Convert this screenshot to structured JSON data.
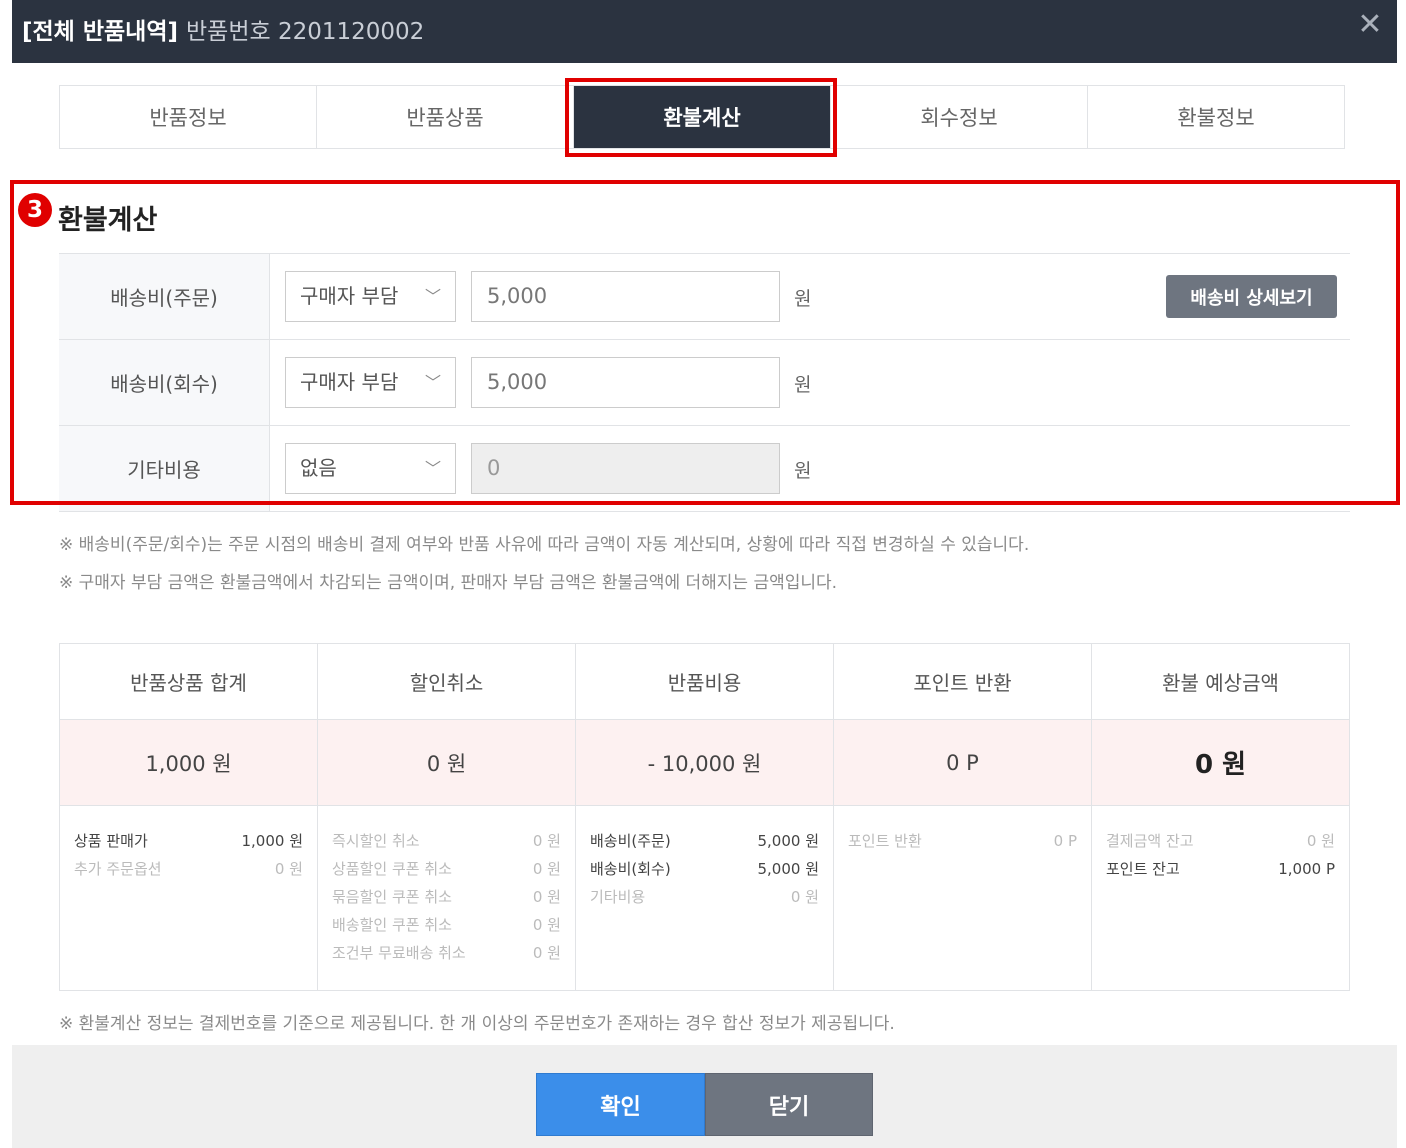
{
  "header": {
    "title": "[전체 반품내역]",
    "subtitle": "반품번호 2201120002",
    "close_icon": "close-icon"
  },
  "tabs": [
    {
      "label": "반품정보",
      "active": false
    },
    {
      "label": "반품상품",
      "active": false
    },
    {
      "label": "환불계산",
      "active": true
    },
    {
      "label": "회수정보",
      "active": false
    },
    {
      "label": "환불정보",
      "active": false
    }
  ],
  "section": {
    "badge": "3",
    "title": "환불계산"
  },
  "form": {
    "unit": "원",
    "detail_button": "배송비 상세보기",
    "rows": [
      {
        "label": "배송비(주문)",
        "select": "구매자 부담",
        "amount": "5,000"
      },
      {
        "label": "배송비(회수)",
        "select": "구매자 부담",
        "amount": "5,000"
      },
      {
        "label": "기타비용",
        "select": "없음",
        "amount": "0"
      }
    ]
  },
  "notes": [
    "※ 배송비(주문/회수)는 주문 시점의 배송비 결제 여부와 반품 사유에 따라 금액이 자동 계산되며, 상황에 따라 직접 변경하실 수 있습니다.",
    "※ 구매자 부담 금액은 환불금액에서 차감되는 금액이며, 판매자 부담 금액은 환불금액에 더해지는 금액입니다."
  ],
  "summary": [
    {
      "head": "반품상품 합계",
      "value": "1,000 원",
      "details": [
        {
          "label": "상품 판매가",
          "value": "1,000 원"
        },
        {
          "label": "추가 주문옵션",
          "value": "0 원"
        }
      ]
    },
    {
      "head": "할인취소",
      "value": "0 원",
      "details": [
        {
          "label": "즉시할인 취소",
          "value": "0 원"
        },
        {
          "label": "상품할인 쿠폰 취소",
          "value": "0 원"
        },
        {
          "label": "묶음할인 쿠폰 취소",
          "value": "0 원"
        },
        {
          "label": "배송할인 쿠폰 취소",
          "value": "0 원"
        },
        {
          "label": "조건부 무료배송 취소",
          "value": "0 원"
        }
      ]
    },
    {
      "head": "반품비용",
      "value": "- 10,000 원",
      "details": [
        {
          "label": "배송비(주문)",
          "value": "5,000 원"
        },
        {
          "label": "배송비(회수)",
          "value": "5,000 원"
        },
        {
          "label": "기타비용",
          "value": "0 원"
        }
      ]
    },
    {
      "head": "포인트 반환",
      "value": "0 P",
      "details": [
        {
          "label": "포인트 반환",
          "value": "0 P"
        }
      ]
    },
    {
      "head": "환불 예상금액",
      "value": "0 원",
      "details": [
        {
          "label": "결제금액 잔고",
          "value": "0 원"
        },
        {
          "label": "포인트 잔고",
          "value": "1,000 P"
        }
      ]
    }
  ],
  "footer_note": "※ 환불계산 정보는 결제번호를 기준으로 제공됩니다. 한 개 이상의 주문번호가 존재하는 경우 합산 정보가 제공됩니다.",
  "buttons": {
    "confirm": "확인",
    "close": "닫기"
  },
  "colors": {
    "header_bg": "#2b3340",
    "highlight": "#e00000",
    "confirm": "#3b8eea",
    "secondary": "#6e7580"
  }
}
